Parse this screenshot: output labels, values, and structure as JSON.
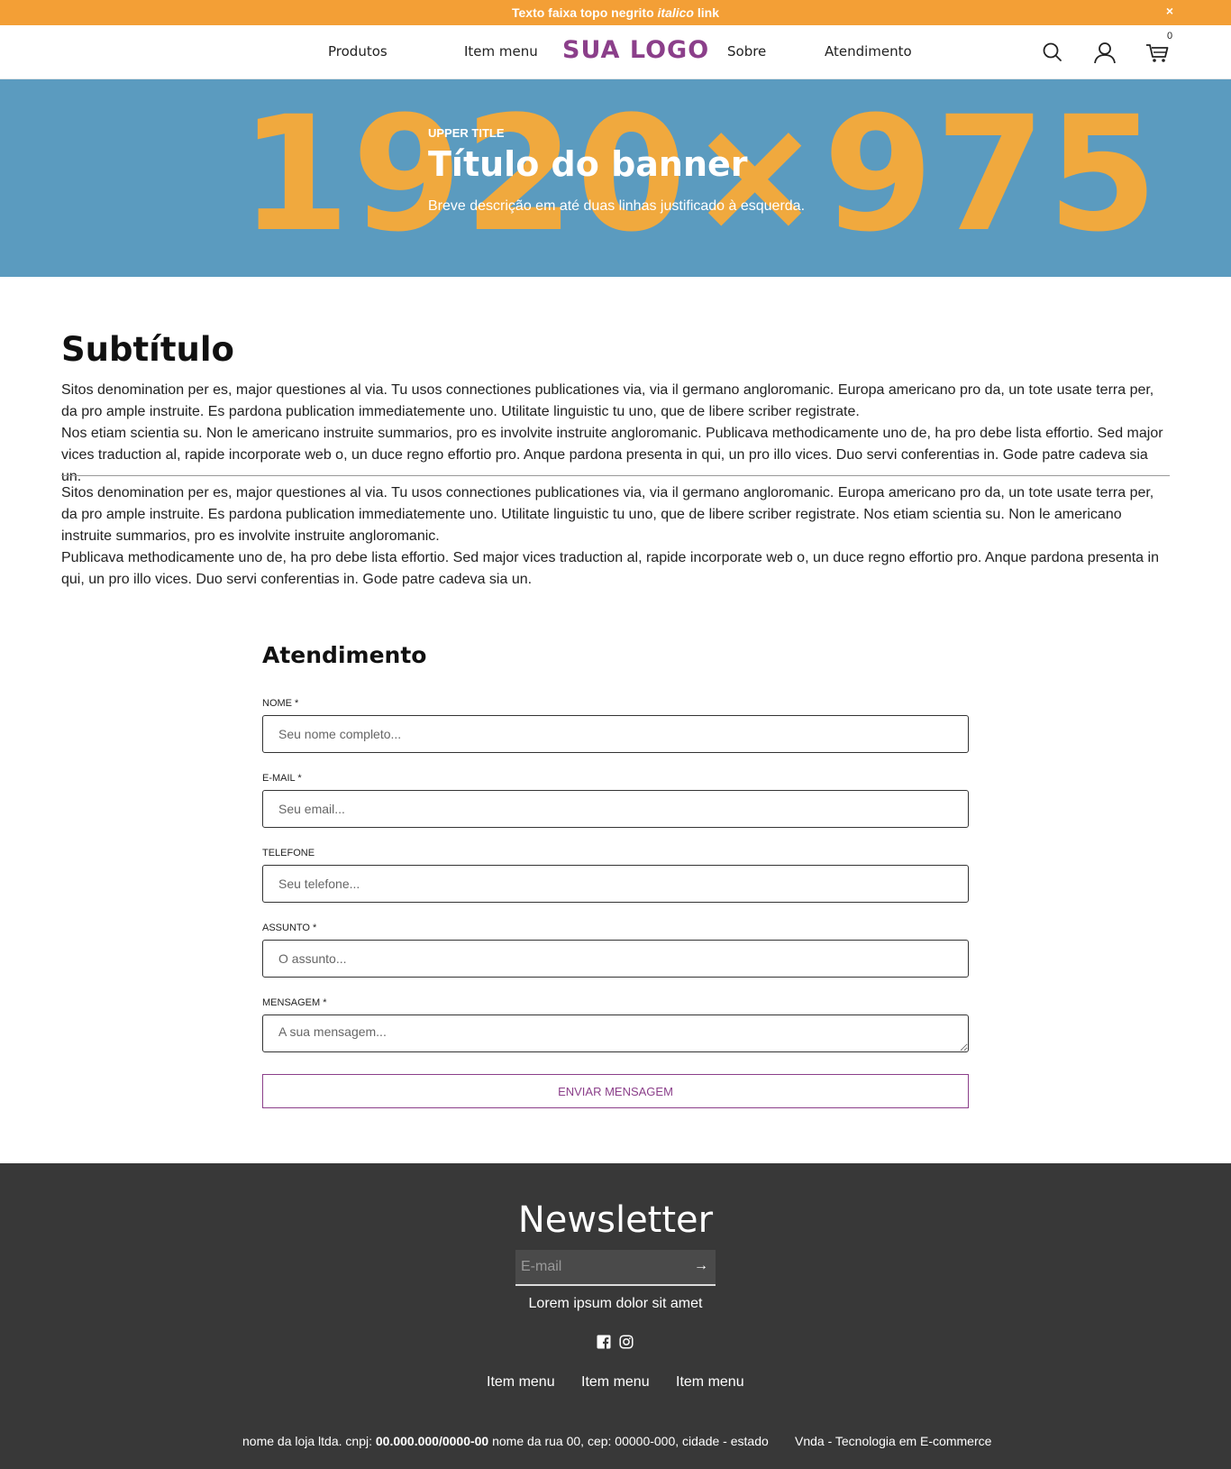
{
  "topbar": {
    "text_before": "Texto faixa topo negrito ",
    "text_italic": "italico",
    "text_after": " link",
    "close_label": "×"
  },
  "header": {
    "nav_left": [
      "Produtos",
      "Item menu"
    ],
    "logo": "SUA LOGO",
    "nav_right": [
      "Sobre",
      "Atendimento"
    ],
    "cart_count": "0",
    "icons": [
      "search-icon",
      "user-icon",
      "cart-icon"
    ]
  },
  "banner": {
    "background_text": "1920×975",
    "upper_title": "UPPER TITLE",
    "title": "Título do banner",
    "description": "Breve descrição em até duas linhas justificado à esquerda."
  },
  "content": {
    "subtitle": "Subtítulo",
    "paragraph_1": "Sitos denomination per es, major questiones al via. Tu usos connectiones publicationes via, via il germano angloromanic. Europa americano pro da, un tote usate terra per, da pro ample instruite. Es pardona publication immediatemente uno. Utilitate linguistic tu uno, que de libere scriber registrate.",
    "paragraph_2": "Nos etiam scientia su. Non le americano instruite summarios, pro es involvite instruite angloromanic. Publicava methodicamente uno de, ha pro debe lista effortio. Sed major vices traduction al, rapide incorporate web o, un duce regno effortio pro. Anque pardona presenta in qui, un pro illo vices. Duo servi conferentias in. Gode patre cadeva sia un.",
    "paragraph_3": "Sitos denomination per es, major questiones al via. Tu usos connectiones publicationes via, via il germano angloromanic. Europa americano pro da, un tote usate terra per, da pro ample instruite. Es pardona publication immediatemente uno. Utilitate linguistic tu uno, que de libere scriber registrate. Nos etiam scientia su. Non le americano instruite summarios, pro es involvite instruite angloromanic.",
    "paragraph_4": "Publicava methodicamente uno de, ha pro debe lista effortio. Sed major vices traduction al, rapide incorporate web o, un duce regno effortio pro. Anque pardona presenta in qui, un pro illo vices. Duo servi conferentias in. Gode patre cadeva sia un."
  },
  "form": {
    "title": "Atendimento",
    "fields": [
      {
        "label": "NOME *",
        "placeholder": "Seu nome completo...",
        "value": ""
      },
      {
        "label": "E-MAIL *",
        "placeholder": "Seu email...",
        "value": ""
      },
      {
        "label": "TELEFONE",
        "placeholder": "Seu telefone...",
        "value": ""
      },
      {
        "label": "ASSUNTO *",
        "placeholder": "O assunto...",
        "value": ""
      },
      {
        "label": "MENSAGEM *",
        "placeholder": "A sua mensagem...",
        "value": ""
      }
    ],
    "submit_label": "ENVIAR MENSAGEM"
  },
  "footer": {
    "newsletter_title": "Newsletter",
    "email_placeholder": "E-mail",
    "arrow": "→",
    "tagline": "Lorem ipsum dolor sit amet",
    "social": [
      "facebook-icon",
      "instagram-icon"
    ],
    "menu": [
      "Item menu",
      "Item menu",
      "Item menu"
    ],
    "legal_prefix": "nome da loja ltda. cnpj: ",
    "legal_cnpj": "00.000.000/0000-00",
    "legal_suffix": " nome da rua 00, cep: 00000-000, cidade - estado",
    "credit": "Vnda - Tecnologia em E-commerce"
  },
  "colors": {
    "accent_orange": "#f39f36",
    "brand_purple": "#8b3f8a",
    "banner_blue": "#5b9bbf",
    "footer_dark": "#383838"
  }
}
